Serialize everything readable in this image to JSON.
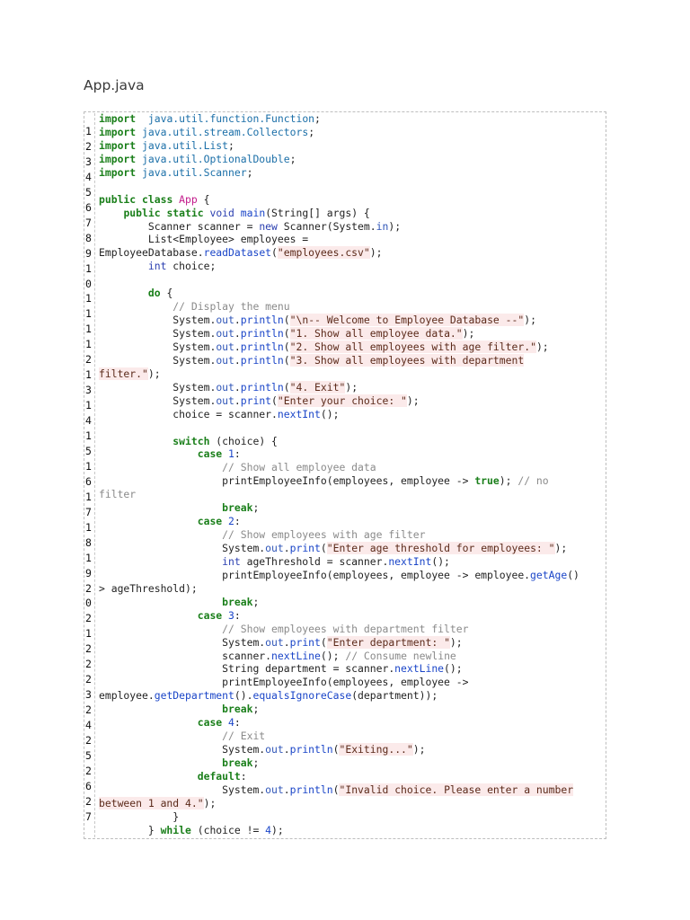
{
  "document": {
    "title": "App.java",
    "gutter_numbers": [
      "1",
      "2",
      "3",
      "4",
      "5",
      "6",
      "7",
      "8",
      "9",
      "1",
      "0",
      "1",
      "1",
      "1",
      "1",
      "2",
      "1",
      "3",
      "1",
      "4",
      "1",
      "5",
      "1",
      "6",
      "1",
      "7",
      "1",
      "8",
      "1",
      "9",
      "2",
      "0",
      "2",
      "1",
      "2",
      "2",
      "2",
      "3",
      "2",
      "4",
      "2",
      "5",
      "2",
      "6",
      "2",
      "7"
    ],
    "code_lines": [
      [
        [
          "kw",
          "import"
        ],
        [
          "",
          "  "
        ],
        [
          "pkg",
          "java.util.function.Function"
        ],
        [
          "",
          ";"
        ]
      ],
      [
        [
          "kw",
          "import"
        ],
        [
          "",
          ""
        ],
        [
          "pkg",
          " java.util.stream.Collectors"
        ],
        [
          "",
          ";"
        ]
      ],
      [
        [
          "kw",
          "import"
        ],
        [
          "pkg",
          " java.util.List"
        ],
        [
          "",
          ";"
        ]
      ],
      [
        [
          "kw",
          "import"
        ],
        [
          "pkg",
          " java.util.OptionalDouble"
        ],
        [
          "",
          ";"
        ]
      ],
      [
        [
          "kw",
          "import"
        ],
        [
          "pkg",
          " java.util.Scanner"
        ],
        [
          "",
          ";"
        ]
      ],
      [
        [
          "",
          ""
        ]
      ],
      [
        [
          "kw",
          "public"
        ],
        [
          "",
          " "
        ],
        [
          "kw",
          "class"
        ],
        [
          "",
          " "
        ],
        [
          "cls",
          "App"
        ],
        [
          "",
          " {"
        ]
      ],
      [
        [
          "",
          "    "
        ],
        [
          "kw",
          "public"
        ],
        [
          "",
          " "
        ],
        [
          "kw",
          "static"
        ],
        [
          "",
          " "
        ],
        [
          "kw2",
          "void"
        ],
        [
          "",
          " "
        ],
        [
          "fn",
          "main"
        ],
        [
          "",
          "(String[] args) {"
        ]
      ],
      [
        [
          "",
          "        Scanner scanner = "
        ],
        [
          "kw2",
          "new"
        ],
        [
          "",
          " Scanner(System."
        ],
        [
          "fld",
          "in"
        ],
        [
          "",
          ");"
        ]
      ],
      [
        [
          "",
          "        List<Employee> employees ="
        ]
      ],
      [
        [
          "",
          "EmployeeDatabase."
        ],
        [
          "fn",
          "readDataset"
        ],
        [
          "",
          "("
        ],
        [
          "str",
          "\"employees.csv\""
        ],
        [
          "",
          ");"
        ]
      ],
      [
        [
          "",
          "        "
        ],
        [
          "kw2",
          "int"
        ],
        [
          "",
          " choice;"
        ]
      ],
      [
        [
          "",
          ""
        ]
      ],
      [
        [
          "",
          "        "
        ],
        [
          "kw",
          "do"
        ],
        [
          "",
          " {"
        ]
      ],
      [
        [
          "",
          "            "
        ],
        [
          "com",
          "// Display the menu"
        ]
      ],
      [
        [
          "",
          "            System."
        ],
        [
          "fld",
          "out"
        ],
        [
          "",
          "."
        ],
        [
          "fn",
          "println"
        ],
        [
          "",
          "("
        ],
        [
          "str",
          "\"\\n-- Welcome to Employee Database --\""
        ],
        [
          "",
          ");"
        ]
      ],
      [
        [
          "",
          "            System."
        ],
        [
          "fld",
          "out"
        ],
        [
          "",
          "."
        ],
        [
          "fn",
          "println"
        ],
        [
          "",
          "("
        ],
        [
          "str",
          "\"1. Show all employee data.\""
        ],
        [
          "",
          ");"
        ]
      ],
      [
        [
          "",
          "            System."
        ],
        [
          "fld",
          "out"
        ],
        [
          "",
          "."
        ],
        [
          "fn",
          "println"
        ],
        [
          "",
          "("
        ],
        [
          "str",
          "\"2. Show all employees with age filter.\""
        ],
        [
          "",
          ");"
        ]
      ],
      [
        [
          "",
          "            System."
        ],
        [
          "fld",
          "out"
        ],
        [
          "",
          "."
        ],
        [
          "fn",
          "println"
        ],
        [
          "",
          "("
        ],
        [
          "str",
          "\"3. Show all employees with department"
        ]
      ],
      [
        [
          "str",
          "filter.\""
        ],
        [
          "",
          ");"
        ]
      ],
      [
        [
          "",
          "            System."
        ],
        [
          "fld",
          "out"
        ],
        [
          "",
          "."
        ],
        [
          "fn",
          "println"
        ],
        [
          "",
          "("
        ],
        [
          "str",
          "\"4. Exit\""
        ],
        [
          "",
          ");"
        ]
      ],
      [
        [
          "",
          "            System."
        ],
        [
          "fld",
          "out"
        ],
        [
          "",
          "."
        ],
        [
          "fn",
          "print"
        ],
        [
          "",
          "("
        ],
        [
          "str",
          "\"Enter your choice: \""
        ],
        [
          "",
          ");"
        ]
      ],
      [
        [
          "",
          "            choice = scanner."
        ],
        [
          "fn",
          "nextInt"
        ],
        [
          "",
          "();"
        ]
      ],
      [
        [
          "",
          ""
        ]
      ],
      [
        [
          "",
          "            "
        ],
        [
          "kw",
          "switch"
        ],
        [
          "",
          " (choice) {"
        ]
      ],
      [
        [
          "",
          "                "
        ],
        [
          "kw",
          "case"
        ],
        [
          "",
          " "
        ],
        [
          "num",
          "1"
        ],
        [
          "",
          ":"
        ]
      ],
      [
        [
          "",
          "                    "
        ],
        [
          "com",
          "// Show all employee data"
        ]
      ],
      [
        [
          "",
          "                    printEmployeeInfo(employees, employee -> "
        ],
        [
          "kw",
          "true"
        ],
        [
          "",
          "); "
        ],
        [
          "com",
          "// no"
        ]
      ],
      [
        [
          "com",
          "filter"
        ]
      ],
      [
        [
          "",
          "                    "
        ],
        [
          "kw",
          "break"
        ],
        [
          "",
          ";"
        ]
      ],
      [
        [
          "",
          "                "
        ],
        [
          "kw",
          "case"
        ],
        [
          "",
          " "
        ],
        [
          "num",
          "2"
        ],
        [
          "",
          ":"
        ]
      ],
      [
        [
          "",
          "                    "
        ],
        [
          "com",
          "// Show employees with age filter"
        ]
      ],
      [
        [
          "",
          "                    System."
        ],
        [
          "fld",
          "out"
        ],
        [
          "",
          "."
        ],
        [
          "fn",
          "print"
        ],
        [
          "",
          "("
        ],
        [
          "str",
          "\"Enter age threshold for employees: \""
        ],
        [
          "",
          ");"
        ]
      ],
      [
        [
          "",
          "                    "
        ],
        [
          "kw2",
          "int"
        ],
        [
          "",
          " ageThreshold = scanner."
        ],
        [
          "fn",
          "nextInt"
        ],
        [
          "",
          "();"
        ]
      ],
      [
        [
          "",
          "                    printEmployeeInfo(employees, employee -> employee."
        ],
        [
          "fn",
          "getAge"
        ],
        [
          "",
          "()"
        ]
      ],
      [
        [
          "",
          "> ageThreshold);"
        ]
      ],
      [
        [
          "",
          "                    "
        ],
        [
          "kw",
          "break"
        ],
        [
          "",
          ";"
        ]
      ],
      [
        [
          "",
          "                "
        ],
        [
          "kw",
          "case"
        ],
        [
          "",
          " "
        ],
        [
          "num",
          "3"
        ],
        [
          "",
          ":"
        ]
      ],
      [
        [
          "",
          "                    "
        ],
        [
          "com",
          "// Show employees with department filter"
        ]
      ],
      [
        [
          "",
          "                    System."
        ],
        [
          "fld",
          "out"
        ],
        [
          "",
          "."
        ],
        [
          "fn",
          "print"
        ],
        [
          "",
          "("
        ],
        [
          "str",
          "\"Enter department: \""
        ],
        [
          "",
          ");"
        ]
      ],
      [
        [
          "",
          "                    scanner."
        ],
        [
          "fn",
          "nextLine"
        ],
        [
          "",
          "(); "
        ],
        [
          "com",
          "// Consume newline"
        ]
      ],
      [
        [
          "",
          "                    String department = scanner."
        ],
        [
          "fn",
          "nextLine"
        ],
        [
          "",
          "();"
        ]
      ],
      [
        [
          "",
          "                    printEmployeeInfo(employees, employee ->"
        ]
      ],
      [
        [
          "",
          "employee."
        ],
        [
          "fn",
          "getDepartment"
        ],
        [
          "",
          "()."
        ],
        [
          "fn",
          "equalsIgnoreCase"
        ],
        [
          "",
          "(department));"
        ]
      ],
      [
        [
          "",
          "                    "
        ],
        [
          "kw",
          "break"
        ],
        [
          "",
          ";"
        ]
      ],
      [
        [
          "",
          "                "
        ],
        [
          "kw",
          "case"
        ],
        [
          "",
          " "
        ],
        [
          "num",
          "4"
        ],
        [
          "",
          ":"
        ]
      ],
      [
        [
          "",
          "                    "
        ],
        [
          "com",
          "// Exit"
        ]
      ],
      [
        [
          "",
          "                    System."
        ],
        [
          "fld",
          "out"
        ],
        [
          "",
          "."
        ],
        [
          "fn",
          "println"
        ],
        [
          "",
          "("
        ],
        [
          "str",
          "\"Exiting...\""
        ],
        [
          "",
          ");"
        ]
      ],
      [
        [
          "",
          "                    "
        ],
        [
          "kw",
          "break"
        ],
        [
          "",
          ";"
        ]
      ],
      [
        [
          "",
          "                "
        ],
        [
          "kw",
          "default"
        ],
        [
          "",
          ":"
        ]
      ],
      [
        [
          "",
          "                    System."
        ],
        [
          "fld",
          "out"
        ],
        [
          "",
          "."
        ],
        [
          "fn",
          "println"
        ],
        [
          "",
          "("
        ],
        [
          "str",
          "\"Invalid choice. Please enter a number"
        ]
      ],
      [
        [
          "str",
          "between 1 and 4.\""
        ],
        [
          "",
          ");"
        ]
      ],
      [
        [
          "",
          "            }"
        ]
      ],
      [
        [
          "",
          "        } "
        ],
        [
          "kw",
          "while"
        ],
        [
          "",
          " (choice != "
        ],
        [
          "num",
          "4"
        ],
        [
          "",
          ");"
        ]
      ]
    ]
  }
}
